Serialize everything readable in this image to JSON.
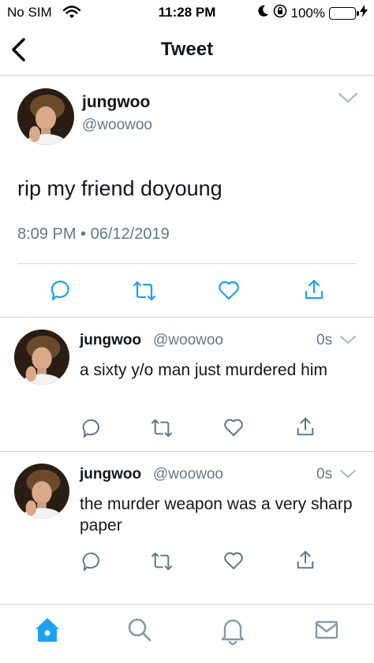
{
  "status_bar": {
    "carrier": "No SIM",
    "time": "11:28 PM",
    "battery": "100%"
  },
  "nav": {
    "title": "Tweet"
  },
  "main_tweet": {
    "name": "jungwoo",
    "handle": "@woowoo",
    "text": "rip my friend doyoung",
    "datetime": "8:09 PM • 06/12/2019"
  },
  "replies": [
    {
      "name": "jungwoo",
      "handle": "@woowoo",
      "time_ago": "0s",
      "text": "a sixty y/o man just murdered him"
    },
    {
      "name": "jungwoo",
      "handle": "@woowoo",
      "time_ago": "0s",
      "text": "the murder weapon was a very sharp paper"
    }
  ],
  "colors": {
    "accent": "#1da1f2",
    "secondary_text": "#657786",
    "icon_gray": "#657786",
    "divider": "#cfd6db",
    "battery_green": "#4cd964"
  },
  "tab_bar": {
    "items": [
      "home-icon",
      "search-icon",
      "notifications-icon",
      "messages-icon"
    ],
    "active": "home-icon"
  }
}
